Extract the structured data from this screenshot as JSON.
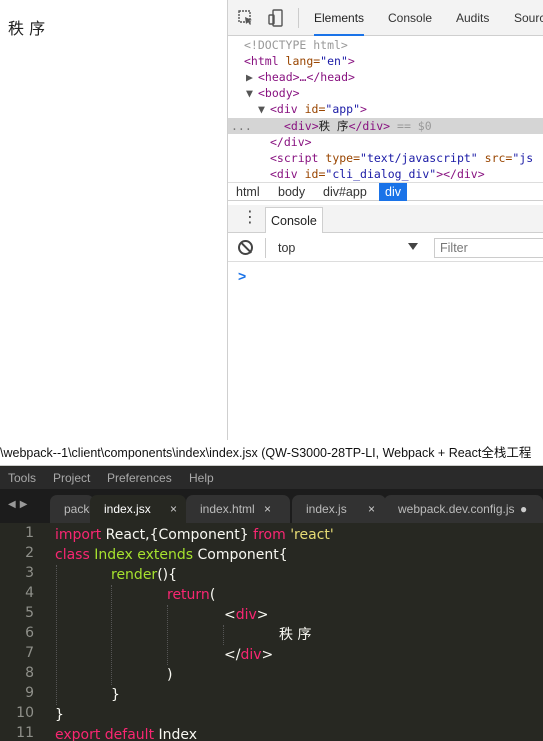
{
  "page": {
    "text": "秩 序"
  },
  "devtools": {
    "tabs": [
      "Elements",
      "Console",
      "Audits",
      "Sources"
    ],
    "elements": {
      "doctype": "<!DOCTYPE html>",
      "html_open_tag": "<html",
      "html_lang_attr": " lang=",
      "html_lang_val": "\"en\"",
      "head": "<head>…</head>",
      "body_open": "<body>",
      "div_app_tag": "<div",
      "div_app_attr": " id=",
      "div_app_val": "\"app\"",
      "inner_div_open": "<div>",
      "inner_div_text": "秩  序",
      "inner_div_close": "</div>",
      "selected_marker": " == $0",
      "div_close": "</div>",
      "script_tag": "<script",
      "script_attr_type": " type=",
      "script_val_type": "\"text/javascript\"",
      "script_attr_src": " src=",
      "script_val_src": "\"js",
      "cli_tag": "<div",
      "cli_attr": " id=",
      "cli_val": "\"cli_dialog_div\"",
      "cli_close": "></div>",
      "ellipsis": "..."
    },
    "breadcrumbs": [
      "html",
      "body",
      "div#app",
      "div"
    ],
    "console_tab": "Console",
    "context": "top",
    "filter_placeholder": "Filter",
    "prompt": ">"
  },
  "editor": {
    "title": "\\webpack--1\\client\\components\\index\\index.jsx (QW-S3000-28TP-LI, Webpack + React全栈工程",
    "menu": [
      "Tools",
      "Project",
      "Preferences",
      "Help"
    ],
    "tabs": [
      {
        "label": "packa"
      },
      {
        "label": "index.jsx",
        "close": "×"
      },
      {
        "label": "index.html",
        "close": "×"
      },
      {
        "label": "index.js",
        "close": "×"
      },
      {
        "label": "webpack.dev.config.js",
        "close": "●"
      }
    ],
    "line_numbers": [
      "1",
      "2",
      "3",
      "4",
      "5",
      "6",
      "7",
      "8",
      "9",
      "10",
      "11"
    ],
    "code": {
      "l1_kw": "import",
      "l1_mid": " React,{Component} ",
      "l1_from": "from",
      "l1_str": " 'react'",
      "l2_kw": "class",
      "l2_cls": " Index",
      "l2_ext": " extends",
      "l2_rest": " Component{",
      "l3_fn": "render",
      "l3_rest": "(){",
      "l4_kw": "return",
      "l4_rest": "(",
      "l5_lt": "<",
      "l5_tag": "div",
      "l5_gt": ">",
      "l6_text": "秩  序",
      "l7_lt": "</",
      "l7_tag": "div",
      "l7_gt": ">",
      "l8": ")",
      "l9": "}",
      "l10": "}",
      "l11_kw": "export default",
      "l11_rest": " Index"
    }
  }
}
